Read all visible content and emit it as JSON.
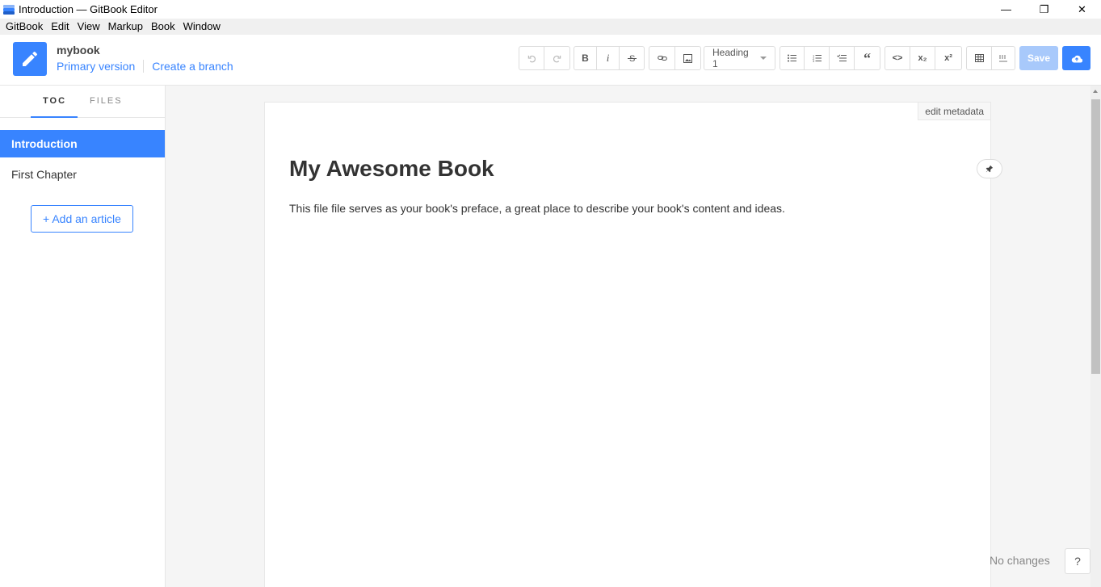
{
  "window": {
    "title": "Introduction — GitBook Editor",
    "controls": {
      "minimize": "—",
      "restore": "❐",
      "close": "✕"
    }
  },
  "menubar": {
    "items": [
      "GitBook",
      "Edit",
      "View",
      "Markup",
      "Book",
      "Window"
    ]
  },
  "header": {
    "book_name": "mybook",
    "version": "Primary version",
    "branch_link": "Create a branch",
    "logo_icon": "pencil-icon",
    "accent_color": "#3884ff"
  },
  "toolbar": {
    "heading_select": "Heading 1",
    "bold": "B",
    "italic": "i",
    "subscript": "x₂",
    "superscript": "x²",
    "quote": "“",
    "code": "<>",
    "save": "Save",
    "icons": [
      "undo-icon",
      "redo-icon",
      "bold-icon",
      "italic-icon",
      "strikethrough-icon",
      "link-icon",
      "image-icon",
      "bullet-list-icon",
      "numbered-list-icon",
      "task-list-icon",
      "quote-icon",
      "code-icon",
      "subscript-icon",
      "superscript-icon",
      "table-icon",
      "math-icon",
      "publish-cloud-icon"
    ]
  },
  "sidebar": {
    "tabs": [
      "TOC",
      "FILES"
    ],
    "active_tab": "TOC",
    "items": [
      {
        "label": "Introduction",
        "active": true
      },
      {
        "label": "First Chapter",
        "active": false
      }
    ],
    "add_article": "+ Add an article"
  },
  "editor": {
    "edit_metadata": "edit metadata",
    "title": "My Awesome Book",
    "body": "This file file serves as your book's preface, a great place to describe your book's content and ideas."
  },
  "status": {
    "text": "No changes",
    "help": "?"
  }
}
